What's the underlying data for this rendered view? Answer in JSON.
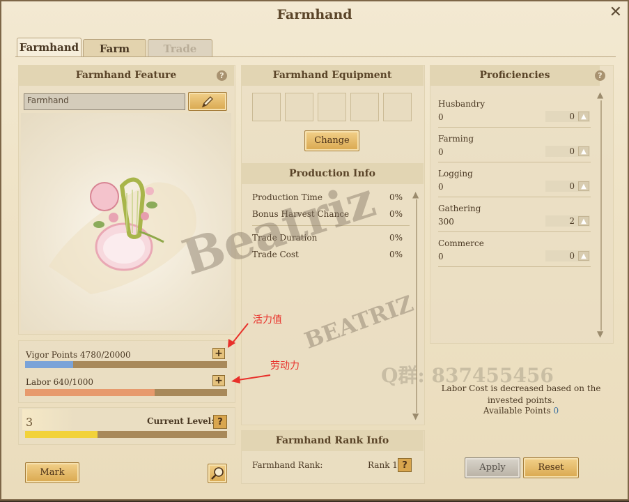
{
  "window": {
    "title": "Farmhand",
    "close_glyph": "✕"
  },
  "tabs": [
    {
      "label": "Farmhand",
      "state": "active"
    },
    {
      "label": "Farm",
      "state": "normal"
    },
    {
      "label": "Trade",
      "state": "disabled"
    }
  ],
  "feature": {
    "header": "Farmhand Feature",
    "help": "?",
    "name_value": "Farmhand",
    "edit_icon": "pencil-icon",
    "portrait": "harp-flower-icon",
    "vigor": {
      "label": "Vigor Points 4780/20000",
      "fill": 0.239,
      "plus": "+",
      "color": "#7aa3d8"
    },
    "labor": {
      "label": "Labor 640/1000",
      "fill": 0.64,
      "plus": "+",
      "color": "#e79a6d"
    },
    "level": {
      "number": "3",
      "label": "Current Level: 3",
      "help": "?",
      "fill": 0.36,
      "color": "#f2d23a"
    }
  },
  "equipment": {
    "header": "Farmhand Equipment",
    "change_label": "Change",
    "slot_count": 5
  },
  "production": {
    "header": "Production Info",
    "rows": [
      {
        "label": "Production Time",
        "value": "0%"
      },
      {
        "label": "Bonus Harvest Chance",
        "value": "0%"
      },
      {
        "label": "Trade Duration",
        "value": "0%"
      },
      {
        "label": "Trade Cost",
        "value": "0%"
      }
    ]
  },
  "rank": {
    "header": "Farmhand Rank Info",
    "label": "Farmhand Rank:",
    "value": "Rank 1",
    "help": "?"
  },
  "proficiencies": {
    "header": "Proficiencies",
    "help": "?",
    "items": [
      {
        "name": "Husbandry",
        "value": "0",
        "invested": "0"
      },
      {
        "name": "Farming",
        "value": "0",
        "invested": "0"
      },
      {
        "name": "Logging",
        "value": "0",
        "invested": "0"
      },
      {
        "name": "Gathering",
        "value": "300",
        "invested": "2"
      },
      {
        "name": "Commerce",
        "value": "0",
        "invested": "0"
      }
    ],
    "note": "Labor Cost is decreased based on the invested points.",
    "available_label": "Available Points",
    "available_value": "0"
  },
  "footer": {
    "mark_label": "Mark",
    "apply_label": "Apply",
    "reset_label": "Reset",
    "search_icon": "magnifier-icon"
  },
  "annotations": {
    "vigor_cn": "活力值",
    "labor_cn": "劳动力"
  },
  "watermark": {
    "main": "Beatriz",
    "sub": "BEATRIZ",
    "qq": "Q群: 837455456"
  },
  "colors": {
    "accent_gold": "#d9a84f",
    "available_points": "#3a6fa0",
    "annotation_red": "#e8302a"
  }
}
